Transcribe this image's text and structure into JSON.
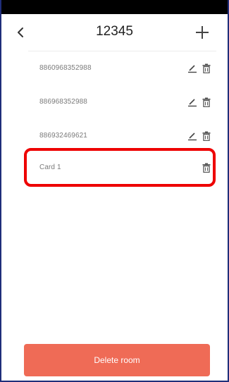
{
  "header": {
    "title": "12345",
    "back_icon": "chevron-left-icon",
    "add_icon": "plus-icon"
  },
  "cards": [
    {
      "label": "8860968352988",
      "editable": true
    },
    {
      "label": "886968352988",
      "editable": true
    },
    {
      "label": "886932469621",
      "editable": true
    }
  ],
  "highlighted_card": {
    "label": "Card 1",
    "editable": false
  },
  "footer": {
    "delete_room_label": "Delete room"
  },
  "colors": {
    "accent_button": "#ef6b56",
    "highlight_border": "#ee0000",
    "frame_border": "#1f2e7a",
    "label_text": "#7a7a7a"
  }
}
